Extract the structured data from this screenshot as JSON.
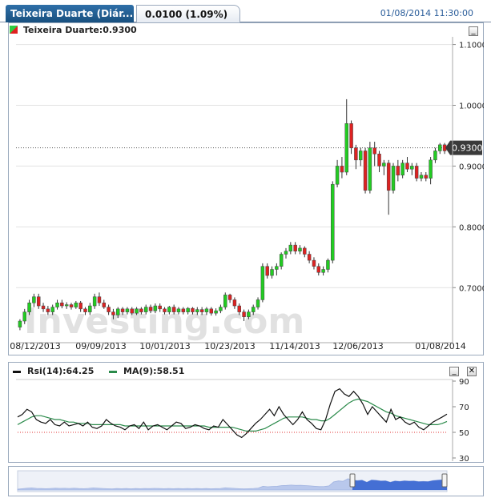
{
  "header": {
    "title": "Teixeira Duarte (Diár...",
    "change": "0.0100 (1.09%)",
    "datetime": "01/08/2014 11:30:00"
  },
  "main_chart": {
    "legend_label": "Teixeira Duarte:0.9300",
    "price_label": "0.9300",
    "y_ticks": [
      "1.1000",
      "1.0000",
      "0.9000",
      "0.8000",
      "0.7000"
    ],
    "x_ticks": [
      "08/12/2013",
      "09/09/2013",
      "10/01/2013",
      "10/23/2013",
      "11/14/2013",
      "12/06/2013",
      "01/08/2014"
    ],
    "watermark": "Investing.com"
  },
  "rsi_panel": {
    "rsi_label": "Rsi(14):64.25",
    "ma_label": "MA(9):58.51",
    "y_ticks": [
      "90",
      "70",
      "50",
      "30"
    ]
  },
  "colors": {
    "up": "#22cc22",
    "down": "#dd2222",
    "rsi_line": "#111111",
    "ma_line": "#2a8a4a",
    "navigator_fill": "#2f5fd0",
    "accent": "#1f5f99"
  },
  "chart_data": {
    "type": "candlestick",
    "title": "Teixeira Duarte",
    "xlabel": "",
    "ylabel": "",
    "ylim": [
      0.62,
      1.11
    ],
    "last_price": 0.93,
    "candles": [
      [
        0.635,
        0.645,
        0.63,
        0.648
      ],
      [
        0.645,
        0.66,
        0.64,
        0.665
      ],
      [
        0.66,
        0.675,
        0.655,
        0.68
      ],
      [
        0.675,
        0.685,
        0.668,
        0.69
      ],
      [
        0.685,
        0.67,
        0.665,
        0.69
      ],
      [
        0.67,
        0.665,
        0.66,
        0.675
      ],
      [
        0.665,
        0.66,
        0.655,
        0.67
      ],
      [
        0.66,
        0.668,
        0.655,
        0.672
      ],
      [
        0.668,
        0.675,
        0.664,
        0.68
      ],
      [
        0.675,
        0.67,
        0.666,
        0.68
      ],
      [
        0.67,
        0.672,
        0.665,
        0.676
      ],
      [
        0.672,
        0.668,
        0.664,
        0.675
      ],
      [
        0.668,
        0.675,
        0.665,
        0.678
      ],
      [
        0.675,
        0.665,
        0.66,
        0.678
      ],
      [
        0.665,
        0.66,
        0.655,
        0.668
      ],
      [
        0.66,
        0.67,
        0.655,
        0.675
      ],
      [
        0.67,
        0.685,
        0.665,
        0.69
      ],
      [
        0.685,
        0.675,
        0.67,
        0.692
      ],
      [
        0.675,
        0.668,
        0.665,
        0.68
      ],
      [
        0.668,
        0.66,
        0.655,
        0.672
      ],
      [
        0.66,
        0.655,
        0.648,
        0.665
      ],
      [
        0.655,
        0.665,
        0.65,
        0.668
      ],
      [
        0.665,
        0.66,
        0.655,
        0.668
      ],
      [
        0.66,
        0.665,
        0.656,
        0.668
      ],
      [
        0.665,
        0.658,
        0.655,
        0.668
      ],
      [
        0.658,
        0.665,
        0.655,
        0.668
      ],
      [
        0.665,
        0.66,
        0.656,
        0.668
      ],
      [
        0.66,
        0.668,
        0.656,
        0.672
      ],
      [
        0.668,
        0.662,
        0.658,
        0.672
      ],
      [
        0.662,
        0.67,
        0.658,
        0.674
      ],
      [
        0.67,
        0.665,
        0.66,
        0.674
      ],
      [
        0.665,
        0.66,
        0.656,
        0.668
      ],
      [
        0.66,
        0.668,
        0.656,
        0.67
      ],
      [
        0.668,
        0.66,
        0.656,
        0.672
      ],
      [
        0.66,
        0.665,
        0.656,
        0.668
      ],
      [
        0.665,
        0.66,
        0.656,
        0.668
      ],
      [
        0.66,
        0.666,
        0.656,
        0.668
      ],
      [
        0.666,
        0.66,
        0.656,
        0.668
      ],
      [
        0.66,
        0.664,
        0.655,
        0.668
      ],
      [
        0.664,
        0.66,
        0.655,
        0.668
      ],
      [
        0.66,
        0.665,
        0.655,
        0.668
      ],
      [
        0.665,
        0.658,
        0.654,
        0.668
      ],
      [
        0.658,
        0.662,
        0.654,
        0.666
      ],
      [
        0.662,
        0.668,
        0.658,
        0.672
      ],
      [
        0.668,
        0.688,
        0.664,
        0.692
      ],
      [
        0.688,
        0.68,
        0.675,
        0.69
      ],
      [
        0.68,
        0.67,
        0.665,
        0.684
      ],
      [
        0.67,
        0.66,
        0.655,
        0.674
      ],
      [
        0.66,
        0.652,
        0.645,
        0.664
      ],
      [
        0.652,
        0.66,
        0.648,
        0.664
      ],
      [
        0.66,
        0.668,
        0.655,
        0.672
      ],
      [
        0.668,
        0.68,
        0.664,
        0.684
      ],
      [
        0.68,
        0.735,
        0.676,
        0.74
      ],
      [
        0.735,
        0.72,
        0.715,
        0.74
      ],
      [
        0.72,
        0.73,
        0.715,
        0.735
      ],
      [
        0.73,
        0.735,
        0.72,
        0.74
      ],
      [
        0.735,
        0.755,
        0.73,
        0.758
      ],
      [
        0.755,
        0.76,
        0.748,
        0.765
      ],
      [
        0.76,
        0.77,
        0.755,
        0.775
      ],
      [
        0.77,
        0.76,
        0.755,
        0.775
      ],
      [
        0.76,
        0.765,
        0.755,
        0.77
      ],
      [
        0.765,
        0.755,
        0.75,
        0.768
      ],
      [
        0.755,
        0.745,
        0.74,
        0.76
      ],
      [
        0.745,
        0.735,
        0.73,
        0.75
      ],
      [
        0.735,
        0.725,
        0.72,
        0.74
      ],
      [
        0.725,
        0.73,
        0.72,
        0.735
      ],
      [
        0.73,
        0.745,
        0.725,
        0.748
      ],
      [
        0.745,
        0.87,
        0.74,
        0.875
      ],
      [
        0.87,
        0.9,
        0.865,
        0.91
      ],
      [
        0.9,
        0.89,
        0.88,
        0.915
      ],
      [
        0.89,
        0.97,
        0.885,
        1.01
      ],
      [
        0.97,
        0.93,
        0.92,
        0.975
      ],
      [
        0.93,
        0.91,
        0.895,
        0.935
      ],
      [
        0.91,
        0.925,
        0.9,
        0.93
      ],
      [
        0.925,
        0.86,
        0.855,
        0.93
      ],
      [
        0.86,
        0.93,
        0.855,
        0.94
      ],
      [
        0.93,
        0.92,
        0.9,
        0.94
      ],
      [
        0.92,
        0.9,
        0.89,
        0.925
      ],
      [
        0.9,
        0.905,
        0.885,
        0.91
      ],
      [
        0.905,
        0.86,
        0.82,
        0.91
      ],
      [
        0.86,
        0.9,
        0.855,
        0.905
      ],
      [
        0.9,
        0.885,
        0.875,
        0.91
      ],
      [
        0.885,
        0.905,
        0.88,
        0.91
      ],
      [
        0.905,
        0.895,
        0.89,
        0.915
      ],
      [
        0.895,
        0.9,
        0.885,
        0.905
      ],
      [
        0.9,
        0.88,
        0.875,
        0.905
      ],
      [
        0.88,
        0.885,
        0.875,
        0.89
      ],
      [
        0.885,
        0.88,
        0.875,
        0.89
      ],
      [
        0.88,
        0.91,
        0.87,
        0.915
      ],
      [
        0.91,
        0.925,
        0.905,
        0.93
      ],
      [
        0.925,
        0.935,
        0.92,
        0.938
      ],
      [
        0.935,
        0.925,
        0.92,
        0.938
      ]
    ],
    "rsi": {
      "name": "Rsi(14)",
      "ylim": [
        30,
        90
      ],
      "values": [
        62,
        64,
        68,
        66,
        60,
        58,
        57,
        60,
        56,
        55,
        58,
        55,
        56,
        57,
        55,
        58,
        54,
        53,
        55,
        60,
        57,
        55,
        54,
        52,
        55,
        56,
        53,
        58,
        52,
        55,
        56,
        54,
        52,
        55,
        58,
        57,
        53,
        54,
        56,
        55,
        53,
        52,
        55,
        54,
        60,
        56,
        52,
        48,
        46,
        49,
        53,
        57,
        60,
        64,
        68,
        63,
        70,
        64,
        60,
        56,
        60,
        66,
        60,
        57,
        53,
        52,
        60,
        72,
        82,
        84,
        80,
        78,
        82,
        78,
        72,
        64,
        70,
        66,
        62,
        58,
        68,
        60,
        62,
        58,
        56,
        58,
        54,
        52,
        55,
        58,
        60,
        62,
        64.25
      ]
    },
    "ma": {
      "name": "MA(9)",
      "values": [
        56,
        58,
        60,
        62,
        63,
        63,
        62,
        61,
        60,
        60,
        59,
        58,
        58,
        57,
        57,
        57,
        56,
        56,
        56,
        56,
        56,
        56,
        56,
        55,
        55,
        55,
        55,
        55,
        55,
        55,
        55,
        55,
        55,
        55,
        55,
        55,
        55,
        55,
        55,
        55,
        55,
        54,
        54,
        54,
        54,
        54,
        54,
        53,
        52,
        51,
        51,
        51,
        52,
        53,
        55,
        57,
        59,
        61,
        62,
        62,
        62,
        62,
        61,
        60,
        60,
        59,
        59,
        61,
        64,
        67,
        70,
        73,
        75,
        76,
        75,
        74,
        72,
        70,
        68,
        66,
        65,
        63,
        62,
        61,
        60,
        59,
        58,
        57,
        56,
        56,
        56,
        57,
        58.51
      ]
    },
    "rsi_reference_line": 50,
    "x_ticks": [
      "08/12/2013",
      "09/09/2013",
      "10/01/2013",
      "10/23/2013",
      "11/14/2013",
      "12/06/2013",
      "01/08/2014"
    ]
  }
}
